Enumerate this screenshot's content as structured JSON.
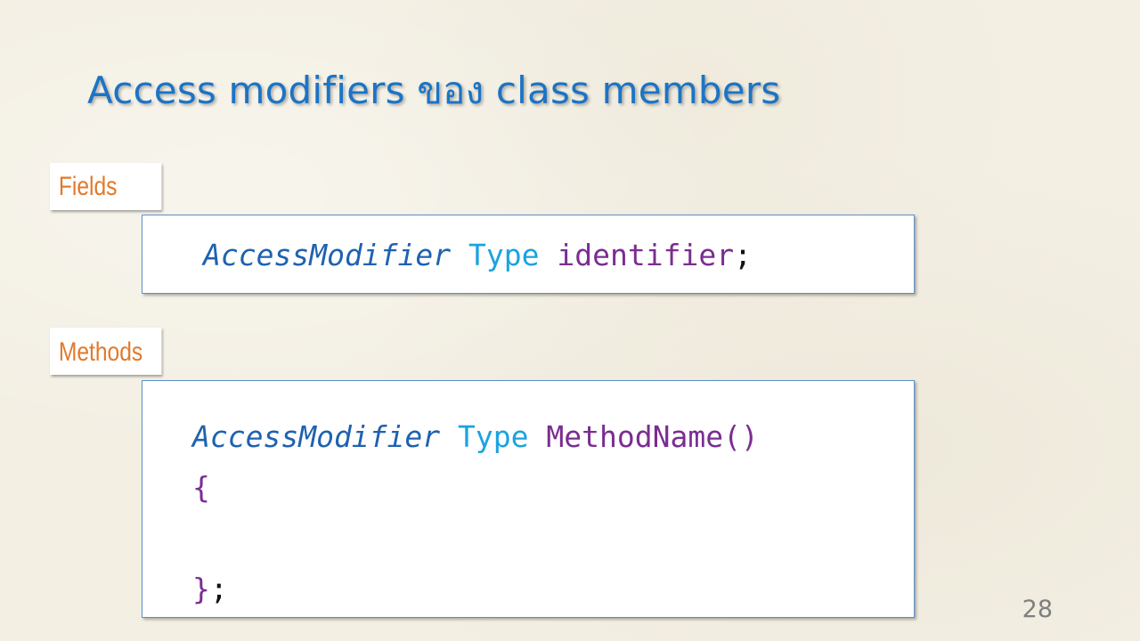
{
  "slide": {
    "title": "Access modifiers  ของ class members",
    "page_number": "28",
    "colors": {
      "title": "#1b74c5",
      "label": "#e07a2c",
      "access_modifier": "#1f62b0",
      "type": "#1aa3e0",
      "identifier": "#7b2d91",
      "box_border": "#5b8fc7"
    }
  },
  "fields": {
    "label": "Fields",
    "modifier": "AccessModifier",
    "type": "Type",
    "identifier": "identifier",
    "terminator": ";"
  },
  "methods": {
    "label": "Methods",
    "modifier": "AccessModifier",
    "type": "Type",
    "name": "MethodName()",
    "open_brace": "{",
    "close_brace": "}",
    "terminator": ";"
  }
}
